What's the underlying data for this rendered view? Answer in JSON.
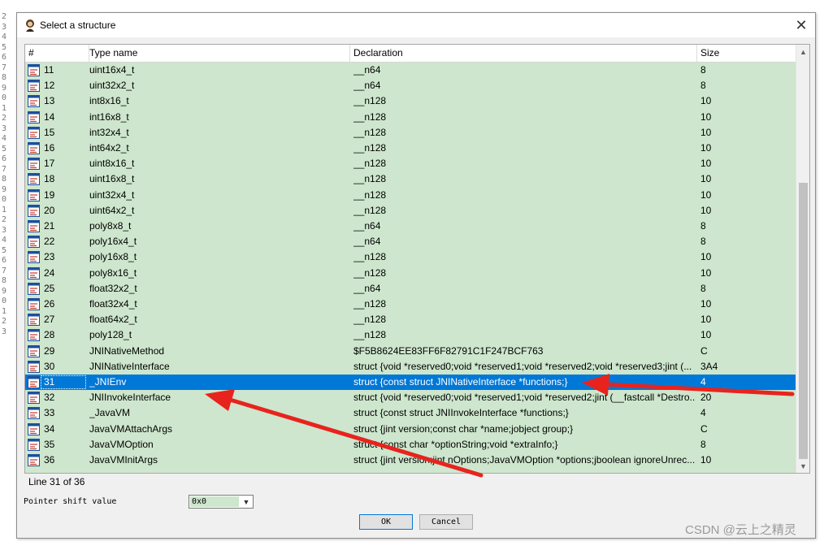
{
  "gutter": [
    "2",
    "3",
    "4",
    "5",
    "6",
    "7",
    "8",
    "9",
    "0",
    "1",
    "2",
    "3",
    "4",
    "5",
    "6",
    "7",
    "8",
    "9",
    "0",
    "1",
    "2",
    "3",
    "4",
    "5",
    "6",
    "7",
    "8",
    "9",
    "0",
    "1",
    "2",
    "3"
  ],
  "dialog": {
    "title": "Select a structure",
    "close_glyph": "✕"
  },
  "table": {
    "columns": [
      "#",
      "Type name",
      "Declaration",
      "Size"
    ],
    "rows": [
      {
        "num": "11",
        "name": "uint16x4_t",
        "decl": "__n64",
        "size": "8"
      },
      {
        "num": "12",
        "name": "uint32x2_t",
        "decl": "__n64",
        "size": "8"
      },
      {
        "num": "13",
        "name": "int8x16_t",
        "decl": "__n128",
        "size": "10"
      },
      {
        "num": "14",
        "name": "int16x8_t",
        "decl": "__n128",
        "size": "10"
      },
      {
        "num": "15",
        "name": "int32x4_t",
        "decl": "__n128",
        "size": "10"
      },
      {
        "num": "16",
        "name": "int64x2_t",
        "decl": "__n128",
        "size": "10"
      },
      {
        "num": "17",
        "name": "uint8x16_t",
        "decl": "__n128",
        "size": "10"
      },
      {
        "num": "18",
        "name": "uint16x8_t",
        "decl": "__n128",
        "size": "10"
      },
      {
        "num": "19",
        "name": "uint32x4_t",
        "decl": "__n128",
        "size": "10"
      },
      {
        "num": "20",
        "name": "uint64x2_t",
        "decl": "__n128",
        "size": "10"
      },
      {
        "num": "21",
        "name": "poly8x8_t",
        "decl": "__n64",
        "size": "8"
      },
      {
        "num": "22",
        "name": "poly16x4_t",
        "decl": "__n64",
        "size": "8"
      },
      {
        "num": "23",
        "name": "poly16x8_t",
        "decl": "__n128",
        "size": "10"
      },
      {
        "num": "24",
        "name": "poly8x16_t",
        "decl": "__n128",
        "size": "10"
      },
      {
        "num": "25",
        "name": "float32x2_t",
        "decl": "__n64",
        "size": "8"
      },
      {
        "num": "26",
        "name": "float32x4_t",
        "decl": "__n128",
        "size": "10"
      },
      {
        "num": "27",
        "name": "float64x2_t",
        "decl": "__n128",
        "size": "10"
      },
      {
        "num": "28",
        "name": "poly128_t",
        "decl": "__n128",
        "size": "10"
      },
      {
        "num": "29",
        "name": "JNINativeMethod",
        "decl": "$F5B8624EE83FF6F82791C1F247BCF763",
        "size": "C"
      },
      {
        "num": "30",
        "name": "JNINativeInterface",
        "decl": "struct {void *reserved0;void *reserved1;void *reserved2;void *reserved3;jint (...",
        "size": "3A4"
      },
      {
        "num": "31",
        "name": "_JNIEnv",
        "decl": "struct {const struct JNINativeInterface *functions;}",
        "size": "4",
        "selected": true
      },
      {
        "num": "32",
        "name": "JNIInvokeInterface",
        "decl": "struct {void *reserved0;void *reserved1;void *reserved2;jint (__fastcall *Destro...",
        "size": "20"
      },
      {
        "num": "33",
        "name": "_JavaVM",
        "decl": "struct {const struct JNIInvokeInterface *functions;}",
        "size": "4"
      },
      {
        "num": "34",
        "name": "JavaVMAttachArgs",
        "decl": "struct {jint version;const char *name;jobject group;}",
        "size": "C"
      },
      {
        "num": "35",
        "name": "JavaVMOption",
        "decl": "struct {const char *optionString;void *extraInfo;}",
        "size": "8"
      },
      {
        "num": "36",
        "name": "JavaVMInitArgs",
        "decl": "struct {jint version;jint nOptions;JavaVMOption *options;jboolean ignoreUnrec...",
        "size": "10"
      }
    ]
  },
  "status": "Line 31 of 36",
  "pointer": {
    "label": "Pointer shift value",
    "value": "0x0"
  },
  "buttons": {
    "ok": "OK",
    "cancel": "Cancel"
  },
  "watermark": "CSDN @云上之精灵",
  "colors": {
    "row_bg": "#cde6cd",
    "selected_bg": "#0078d7",
    "arrow": "#e8231e"
  }
}
